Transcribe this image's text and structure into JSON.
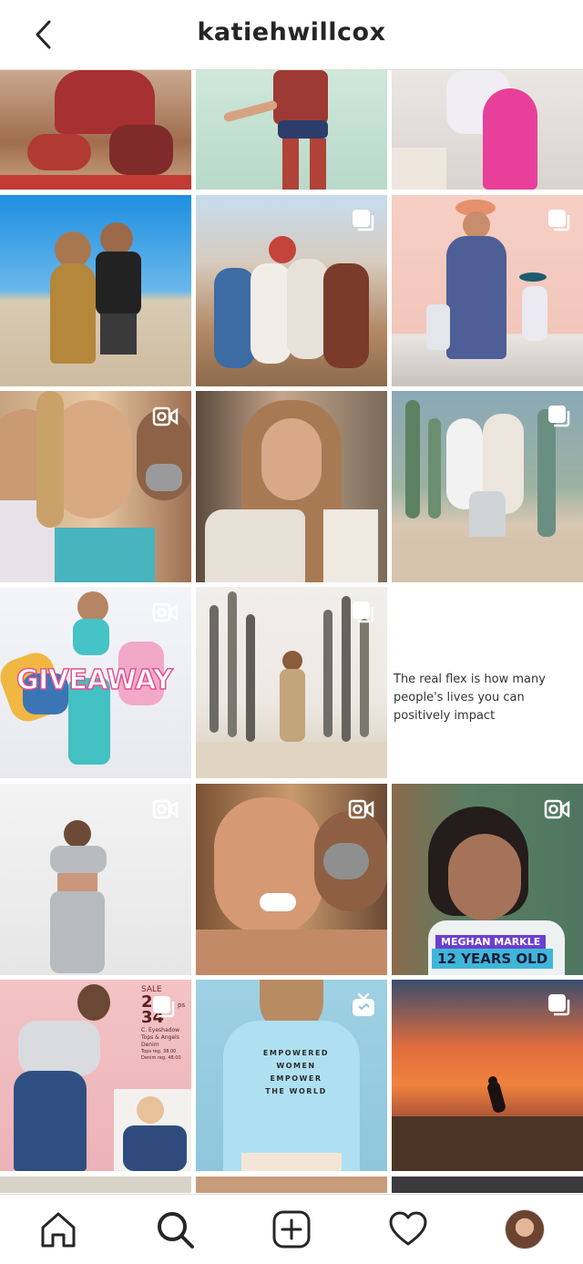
{
  "header": {
    "title": "katiehwillcox",
    "back_icon": "chevron-left-icon"
  },
  "grid": {
    "tiles": [
      {
        "id": "r0c0",
        "badge": "none"
      },
      {
        "id": "r0c1",
        "badge": "none"
      },
      {
        "id": "r0c2",
        "badge": "none"
      },
      {
        "id": "r1c0",
        "badge": "none"
      },
      {
        "id": "r1c1",
        "badge": "carousel"
      },
      {
        "id": "r1c2",
        "badge": "carousel"
      },
      {
        "id": "r2c0",
        "badge": "video"
      },
      {
        "id": "r2c1",
        "badge": "none"
      },
      {
        "id": "r2c2",
        "badge": "carousel"
      },
      {
        "id": "r3c0",
        "badge": "video",
        "overlay": "GIVEAWAY"
      },
      {
        "id": "r3c1",
        "badge": "carousel"
      },
      {
        "id": "r3c2",
        "badge": "none",
        "quote": "The real flex is how many people's lives you can positively impact"
      },
      {
        "id": "r4c0",
        "badge": "video"
      },
      {
        "id": "r4c1",
        "badge": "video"
      },
      {
        "id": "r4c2",
        "badge": "video",
        "caption_top": "MEGHAN MARKLE",
        "caption_main": "12 YEARS OLD"
      },
      {
        "id": "r5c0",
        "badge": "carousel",
        "ad_sale": "SALE",
        "ad_num1": "2",
        "ad_num2": "34",
        "ad_frag": "ps",
        "ad_line1": "C. Eyeshadow",
        "ad_line2": "Tops & Angels",
        "ad_line3": "Denim",
        "ad_line4": "Tops reg. 38.00",
        "ad_line5": "Denim reg. 48.00"
      },
      {
        "id": "r5c1",
        "badge": "igtv",
        "shirt_line1": "EMPOWERED",
        "shirt_line2": "WOMEN",
        "shirt_line3": "EMPOWER",
        "shirt_line4": "THE WORLD"
      },
      {
        "id": "r5c2",
        "badge": "carousel"
      },
      {
        "id": "r6c0",
        "badge": "none"
      },
      {
        "id": "r6c1",
        "badge": "none"
      },
      {
        "id": "r6c2",
        "badge": "none"
      }
    ]
  },
  "tabbar": {
    "items": [
      {
        "name": "home",
        "icon": "home-icon"
      },
      {
        "name": "search",
        "icon": "search-icon",
        "active": true
      },
      {
        "name": "new-post",
        "icon": "plus-square-icon"
      },
      {
        "name": "activity",
        "icon": "heart-icon"
      },
      {
        "name": "profile",
        "icon": "avatar"
      }
    ]
  },
  "colors": {
    "text": "#262626",
    "border": "#dbdbdb",
    "giveaway_pink": "#e6508f",
    "caption_purple": "#6b3fd1",
    "caption_blue": "#3fb6d9"
  }
}
